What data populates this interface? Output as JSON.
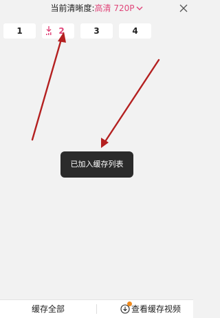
{
  "header": {
    "quality_label": "当前清晰度:",
    "quality_value": "高清 720P",
    "icons": {
      "dropdown": "chevron-down-icon",
      "close": "close-icon"
    }
  },
  "episodes": [
    {
      "label": "1",
      "state": "normal"
    },
    {
      "label": "2",
      "state": "downloading",
      "icon": "download-icon"
    },
    {
      "label": "3",
      "state": "normal"
    },
    {
      "label": "4",
      "state": "normal"
    }
  ],
  "toast": {
    "text": "已加入缓存列表"
  },
  "annotations": {
    "arrow_color": "#b42020"
  },
  "bottom_bar": {
    "cache_all": "缓存全部",
    "view_cached": "查看缓存视频",
    "view_icon": "download-circle-icon",
    "badge_color": "#f08a1c"
  },
  "colors": {
    "accent": "#e0467a",
    "background": "#f2f2f2",
    "toast_bg": "#2b2b2b"
  }
}
